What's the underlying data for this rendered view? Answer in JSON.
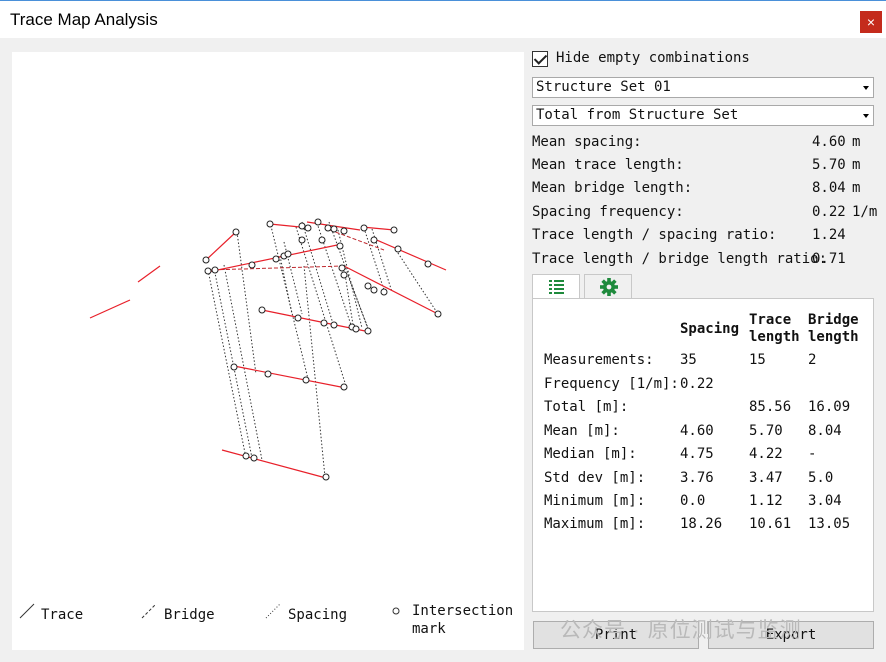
{
  "window": {
    "title": "Trace Map Analysis",
    "close_label": "×"
  },
  "legend": {
    "trace": "Trace",
    "bridge": "Bridge",
    "spacing": "Spacing",
    "intersection_line1": "Intersection",
    "intersection_line2": "mark"
  },
  "options": {
    "hide_empty_label": "Hide empty combinations",
    "hide_empty_checked": true,
    "structure_set": "Structure Set 01",
    "scope": "Total from Structure Set"
  },
  "summary": [
    {
      "label": "Mean spacing:",
      "value": "4.60",
      "unit": "m"
    },
    {
      "label": "Mean trace length:",
      "value": "5.70",
      "unit": "m"
    },
    {
      "label": "Mean bridge length:",
      "value": "8.04",
      "unit": "m"
    },
    {
      "label": "Spacing frequency:",
      "value": "0.22",
      "unit": "1/m"
    },
    {
      "label": "Trace length / spacing ratio:",
      "value": "1.24",
      "unit": ""
    },
    {
      "label": "Trace length / bridge length ratio:",
      "value": "0.71",
      "unit": ""
    }
  ],
  "tabs": [
    {
      "icon": "table-icon",
      "color": "#1e8a3c"
    },
    {
      "icon": "gear-icon",
      "color": "#1e8a3c"
    }
  ],
  "table": {
    "columns": [
      "Spacing",
      "Trace length",
      "Bridge length"
    ],
    "rows": [
      {
        "label": "Measurements:",
        "values": [
          "35",
          "15",
          "2"
        ]
      },
      {
        "label": "Frequency [1/m]:",
        "values": [
          "0.22",
          "",
          ""
        ]
      },
      {
        "label": "Total [m]:",
        "values": [
          "",
          "85.56",
          "16.09"
        ]
      },
      {
        "label": "Mean [m]:",
        "values": [
          "4.60",
          "5.70",
          "8.04"
        ]
      },
      {
        "label": "Median [m]:",
        "values": [
          "4.75",
          "4.22",
          "-"
        ]
      },
      {
        "label": "Std dev [m]:",
        "values": [
          "3.76",
          "3.47",
          "5.0"
        ]
      },
      {
        "label": "Minimum [m]:",
        "values": [
          "0.0",
          "1.12",
          "3.04"
        ]
      },
      {
        "label": "Maximum [m]:",
        "values": [
          "18.26",
          "10.61",
          "13.05"
        ]
      }
    ]
  },
  "buttons": {
    "print": "Print",
    "export": "Export"
  },
  "watermark": "公众号 · 原位测试与监测",
  "colors": {
    "trace": "#e8202a",
    "bridge": "#c0282e",
    "spacing": "#333333",
    "close": "#c42b1c"
  }
}
